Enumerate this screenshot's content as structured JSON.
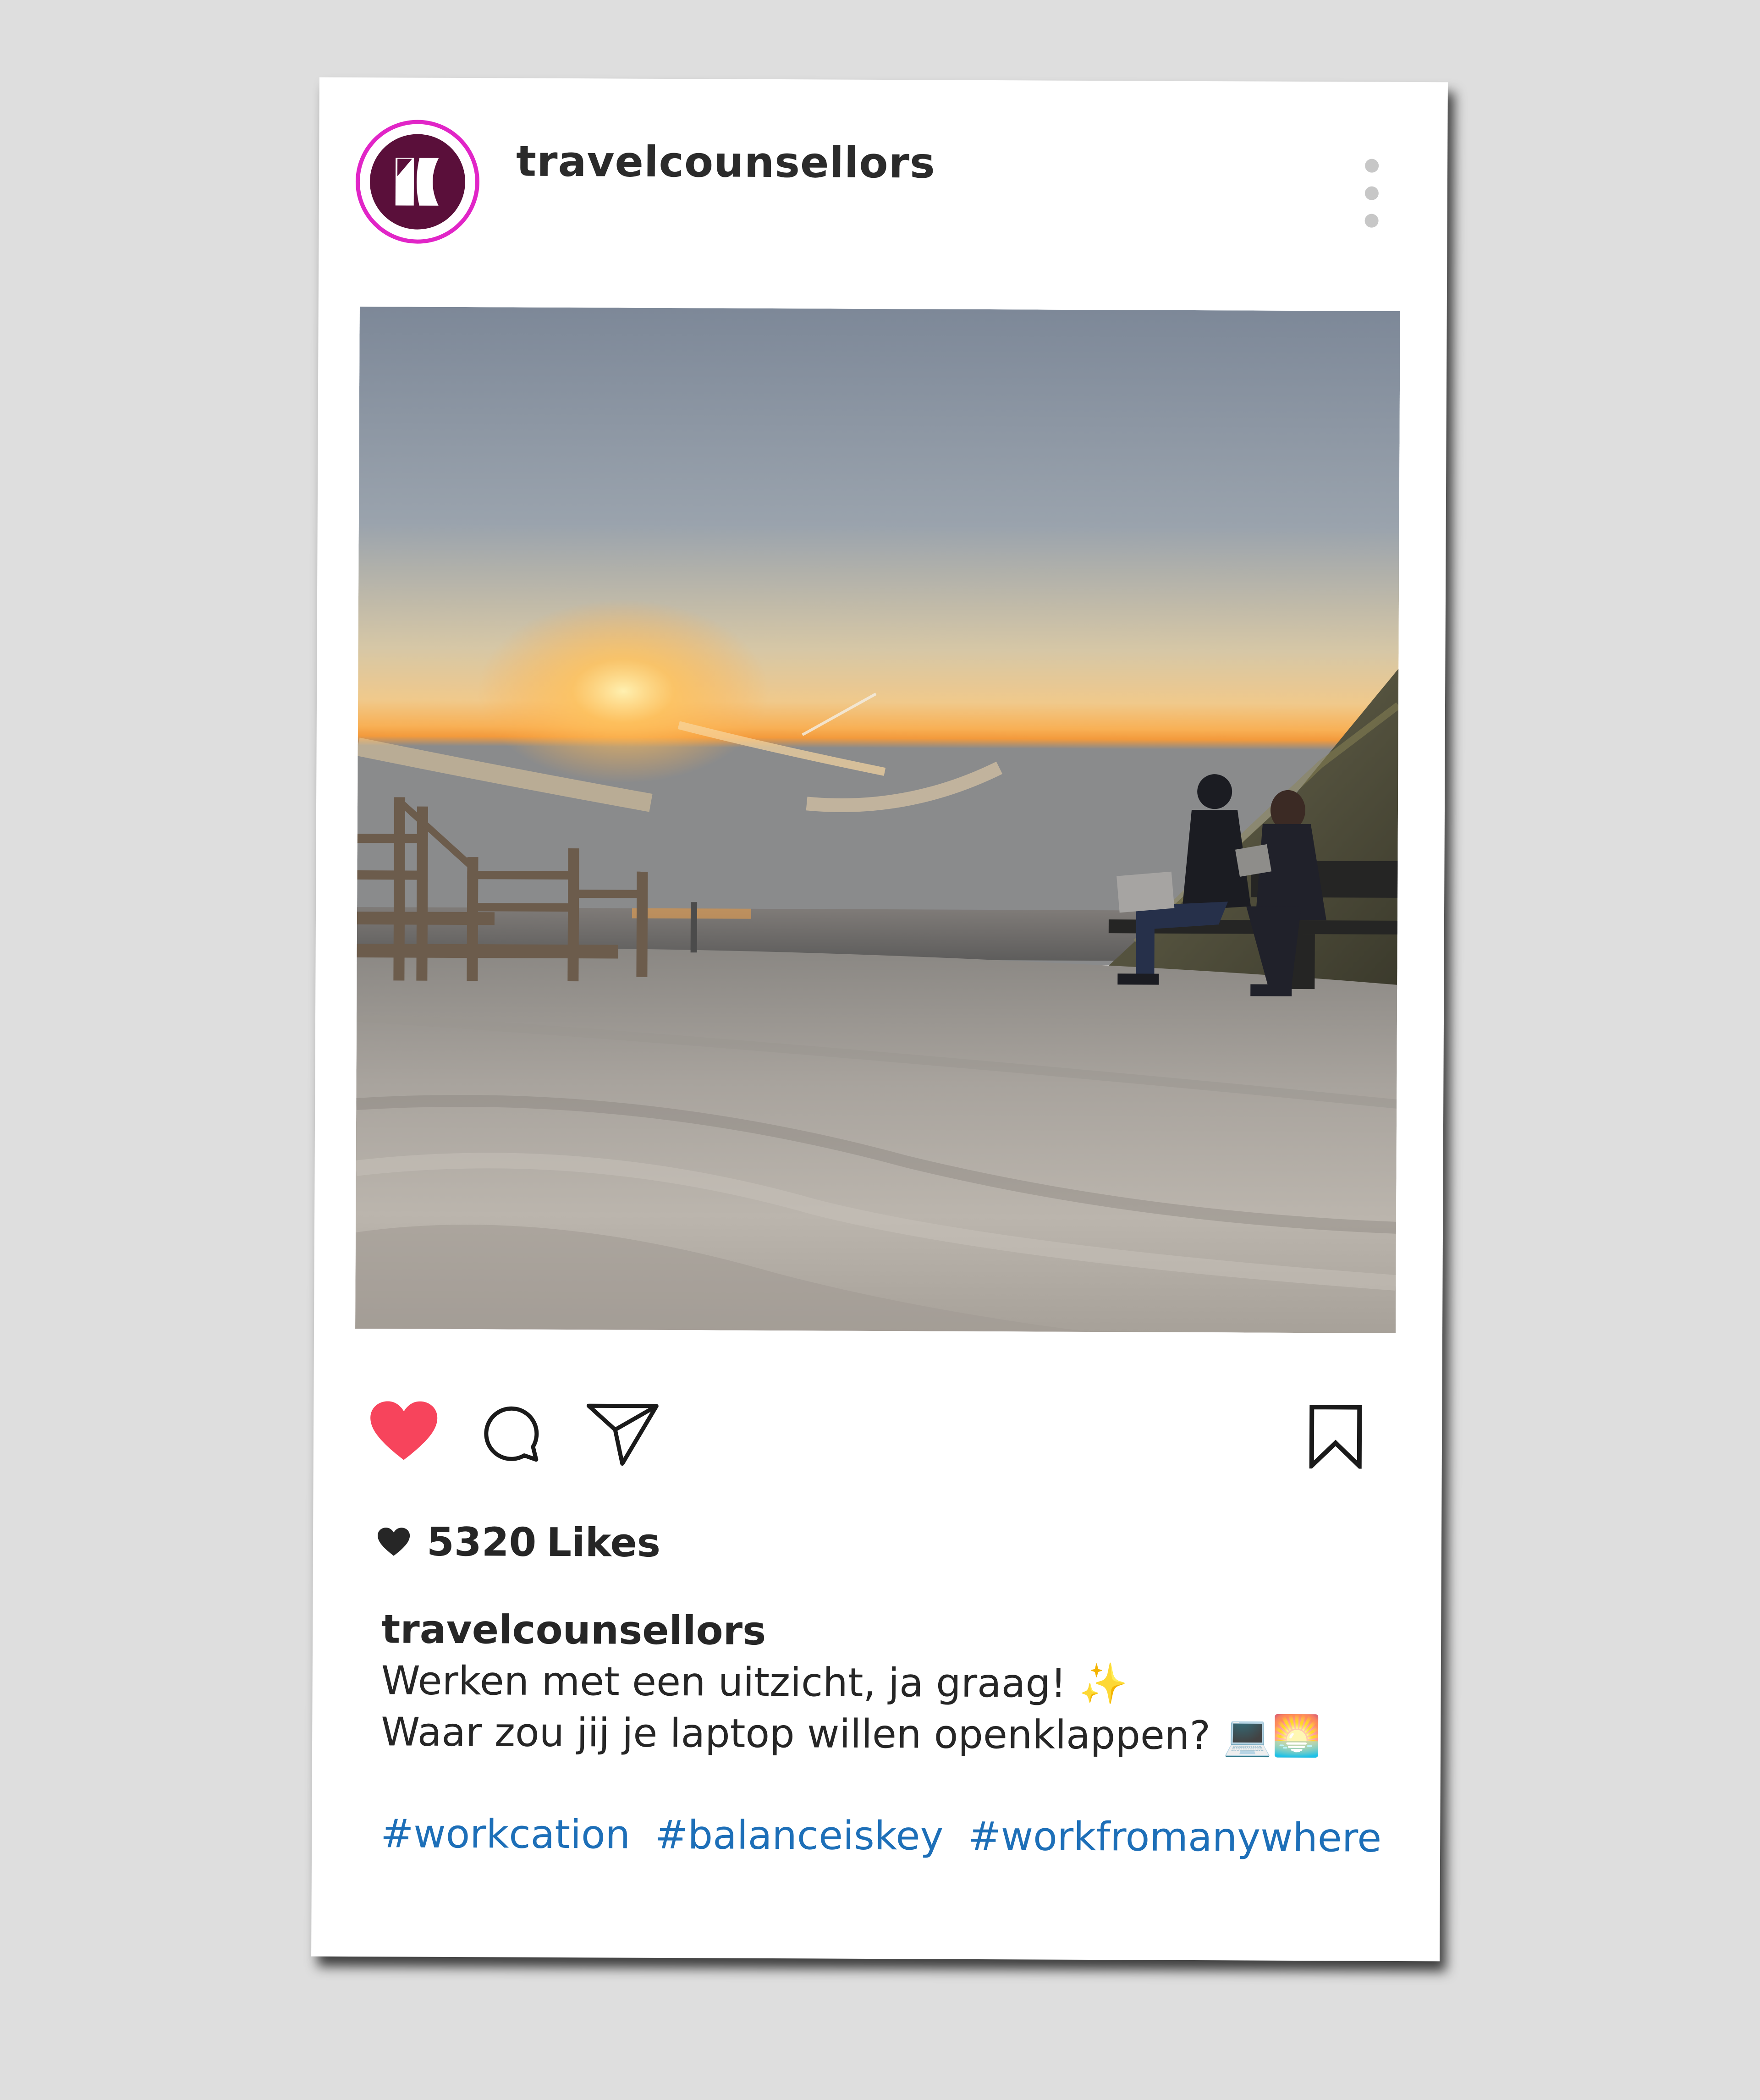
{
  "post": {
    "username": "travelcounsellors",
    "likes": {
      "count": "5320",
      "label": "Likes"
    },
    "caption": {
      "username": "travelcounsellors",
      "lines": [
        "Werken met een uitzicht, ja graag! ✨",
        "Waar zou jij je laptop willen openklappen? 💻🌅"
      ],
      "hashtags": [
        "#workcation",
        "#balanceiskey",
        "#workfromanywhere"
      ]
    },
    "liked": true,
    "colors": {
      "like_red": "#f7445c",
      "avatar_ring": "#e125c7",
      "avatar_bg": "#5a0f3a",
      "hashtag_blue": "#1d6fb8",
      "text_dark": "#262626"
    },
    "icons": {
      "like": "heart-icon",
      "comment": "comment-bubble-icon",
      "share": "paper-plane-icon",
      "save": "bookmark-icon",
      "more": "vertical-dots-icon",
      "likes_heart": "small-heart-icon"
    }
  }
}
